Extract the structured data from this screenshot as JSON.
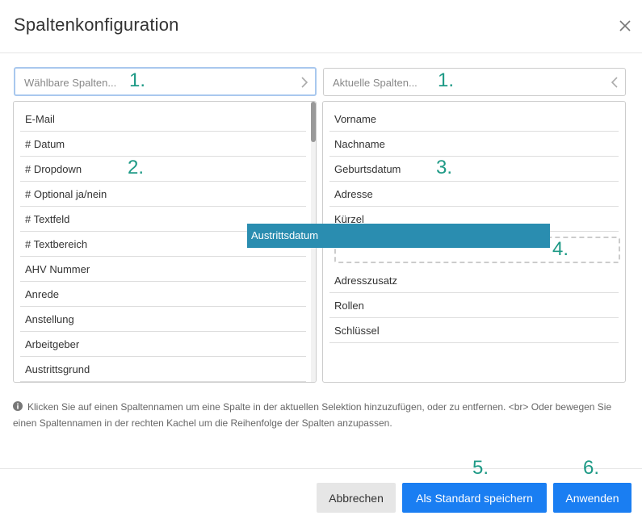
{
  "dialog": {
    "title": "Spaltenkonfiguration"
  },
  "left": {
    "search_placeholder": "Wählbare Spalten...",
    "items": [
      "E-Mail",
      "# Datum",
      "# Dropdown",
      "# Optional ja/nein",
      "# Textfeld",
      "# Textbereich",
      "AHV Nummer",
      "Anrede",
      "Anstellung",
      "Arbeitgeber",
      "Austrittsgrund"
    ]
  },
  "right": {
    "search_placeholder": "Aktuelle Spalten...",
    "items_before": [
      "Vorname",
      "Nachname",
      "Geburtsdatum",
      "Adresse",
      "Kürzel"
    ],
    "items_after": [
      "Adresszusatz",
      "Rollen",
      "Schlüssel"
    ]
  },
  "drag": {
    "label": "Austrittsdatum"
  },
  "info": {
    "text": "Klicken Sie auf einen Spaltennamen um eine Spalte in der aktuellen Selektion hinzuzufügen, oder zu entfernen. <br> Oder bewegen Sie einen Spaltennamen in der rechten Kachel um die Reihenfolge der Spalten anzupassen."
  },
  "annotations": {
    "n1": "1.",
    "n2": "2.",
    "n3": "3.",
    "n4": "4.",
    "n5": "5.",
    "n6": "6."
  },
  "footer": {
    "cancel": "Abbrechen",
    "save_default": "Als Standard speichern",
    "apply": "Anwenden"
  },
  "colors": {
    "primary": "#1a7ef2",
    "drag": "#2a8db0",
    "annotation": "#1e9a86"
  }
}
